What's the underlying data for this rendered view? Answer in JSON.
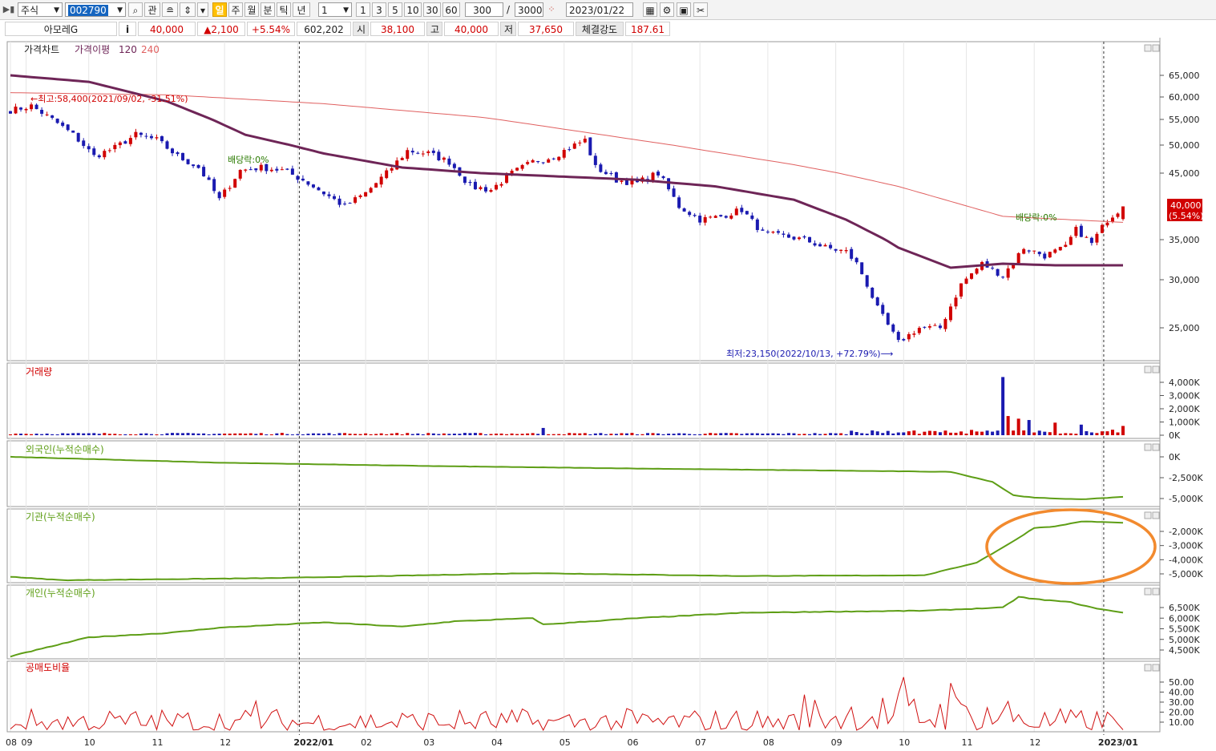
{
  "toolbar": {
    "market": "주식",
    "code": "002790",
    "btn_gwan": "관",
    "periods": [
      "일",
      "주",
      "월",
      "분",
      "틱",
      "년"
    ],
    "active_period": "일",
    "interval_value": "1",
    "intervals": [
      "1",
      "3",
      "5",
      "10",
      "30",
      "60"
    ],
    "count_value": "300",
    "count_sep": "/",
    "count_max": "3000",
    "date": "2023/01/22"
  },
  "quote": {
    "name": "아모레G",
    "info_btn": "i",
    "price": "40,000",
    "change": "▲2,100",
    "change_pct": "+5.54%",
    "volume": "602,202",
    "open_label": "시",
    "open": "38,100",
    "high_label": "고",
    "high": "40,000",
    "low_label": "저",
    "low": "37,650",
    "strength_label": "체결강도",
    "strength": "187.61"
  },
  "chart_data": [
    {
      "type": "candlestick",
      "panel": "price",
      "title": "가격차트",
      "legend": [
        "가격이평",
        "120",
        "240"
      ],
      "y_ticks": [
        65000,
        60000,
        55000,
        50000,
        45000,
        35000,
        30000,
        25000
      ],
      "y_tick_labels": [
        "65,000",
        "60,000",
        "55,000",
        "50,000",
        "45,000",
        "35,000",
        "30,000",
        "25,000"
      ],
      "last_price_label": "40,000",
      "last_pct_label": "(5.54%)",
      "annotations": {
        "high": "←최고:58,400(2021/09/02, -31.51%)",
        "low": "최저:23,150(2022/10/13, +72.79%)⟶",
        "div1": "배당락:0%",
        "div2": "배당락:0%"
      },
      "close_anchors": [
        [
          0,
          57000
        ],
        [
          4,
          58000
        ],
        [
          8,
          55000
        ],
        [
          12,
          52000
        ],
        [
          16,
          48000
        ],
        [
          20,
          49500
        ],
        [
          24,
          52000
        ],
        [
          28,
          51000
        ],
        [
          32,
          48000
        ],
        [
          36,
          46000
        ],
        [
          40,
          41000
        ],
        [
          44,
          45500
        ],
        [
          48,
          46000
        ],
        [
          52,
          45500
        ],
        [
          56,
          44000
        ],
        [
          60,
          42000
        ],
        [
          64,
          40000
        ],
        [
          68,
          42000
        ],
        [
          72,
          45000
        ],
        [
          76,
          49000
        ],
        [
          80,
          48500
        ],
        [
          84,
          47000
        ],
        [
          88,
          43000
        ],
        [
          92,
          42500
        ],
        [
          96,
          45000
        ],
        [
          100,
          47000
        ],
        [
          104,
          48000
        ],
        [
          108,
          50000
        ],
        [
          110,
          51000
        ],
        [
          112,
          46000
        ],
        [
          116,
          44000
        ],
        [
          120,
          43500
        ],
        [
          124,
          45000
        ],
        [
          128,
          40000
        ],
        [
          132,
          38000
        ],
        [
          136,
          38500
        ],
        [
          140,
          39500
        ],
        [
          144,
          36000
        ],
        [
          148,
          35500
        ],
        [
          152,
          35000
        ],
        [
          156,
          34000
        ],
        [
          160,
          33500
        ],
        [
          162,
          32000
        ],
        [
          166,
          27000
        ],
        [
          170,
          23500
        ],
        [
          174,
          25000
        ],
        [
          178,
          25000
        ],
        [
          182,
          29500
        ],
        [
          186,
          32000
        ],
        [
          190,
          30500
        ],
        [
          194,
          34000
        ],
        [
          198,
          33000
        ],
        [
          202,
          34000
        ],
        [
          204,
          36500
        ],
        [
          207,
          34500
        ],
        [
          210,
          38000
        ],
        [
          213,
          40000
        ]
      ],
      "ma120_anchors": [
        [
          0,
          65000
        ],
        [
          15,
          63500
        ],
        [
          30,
          59000
        ],
        [
          45,
          52000
        ],
        [
          60,
          48500
        ],
        [
          75,
          46000
        ],
        [
          90,
          45000
        ],
        [
          105,
          44500
        ],
        [
          120,
          44000
        ],
        [
          135,
          43000
        ],
        [
          150,
          41000
        ],
        [
          160,
          38000
        ],
        [
          170,
          34000
        ],
        [
          180,
          31500
        ],
        [
          190,
          32000
        ],
        [
          200,
          31800
        ],
        [
          213,
          31800
        ]
      ],
      "ma240_anchors": [
        [
          0,
          61000
        ],
        [
          30,
          60500
        ],
        [
          60,
          58500
        ],
        [
          90,
          55500
        ],
        [
          120,
          51000
        ],
        [
          150,
          46500
        ],
        [
          170,
          43000
        ],
        [
          190,
          38500
        ],
        [
          213,
          37600
        ]
      ],
      "last_volume_ticks_note": ""
    },
    {
      "type": "bar",
      "panel": "volume",
      "title": "거래량",
      "y_tick_labels": [
        "4,000K",
        "3,000K",
        "2,000K",
        "1,000K",
        "0K"
      ],
      "y_ticks": [
        4000,
        3000,
        2000,
        1000,
        0
      ],
      "unit": "K",
      "spikes": [
        [
          102,
          550
        ],
        [
          190,
          4400
        ],
        [
          191,
          1450
        ],
        [
          193,
          1250
        ],
        [
          195,
          1150
        ],
        [
          200,
          950
        ],
        [
          205,
          800
        ],
        [
          213,
          700
        ]
      ]
    },
    {
      "type": "line",
      "panel": "foreign",
      "title": "외국인(누적순매수)",
      "y_tick_labels": [
        "0K",
        "-2,500K",
        "-5,000K"
      ],
      "y_ticks": [
        0,
        -2500,
        -5000
      ],
      "anchors": [
        [
          0,
          0
        ],
        [
          40,
          -700
        ],
        [
          80,
          -1100
        ],
        [
          120,
          -1400
        ],
        [
          150,
          -1600
        ],
        [
          180,
          -1800
        ],
        [
          188,
          -3000
        ],
        [
          192,
          -4600
        ],
        [
          196,
          -4900
        ],
        [
          205,
          -5100
        ],
        [
          213,
          -4800
        ]
      ]
    },
    {
      "type": "line",
      "panel": "institution",
      "title": "기관(누적순매수)",
      "y_tick_labels": [
        "-2,000K",
        "-3,000K",
        "-4,000K",
        "-5,000K"
      ],
      "y_ticks": [
        -2000,
        -3000,
        -4000,
        -5000
      ],
      "anchors": [
        [
          0,
          -5200
        ],
        [
          10,
          -5450
        ],
        [
          50,
          -5300
        ],
        [
          100,
          -4950
        ],
        [
          140,
          -5150
        ],
        [
          175,
          -5100
        ],
        [
          185,
          -4200
        ],
        [
          192,
          -2700
        ],
        [
          196,
          -1750
        ],
        [
          200,
          -1650
        ],
        [
          205,
          -1300
        ],
        [
          210,
          -1350
        ],
        [
          213,
          -1400
        ]
      ]
    },
    {
      "type": "line",
      "panel": "individual",
      "title": "개인(누적순매수)",
      "y_tick_labels": [
        "6,500K",
        "6,000K",
        "5,500K",
        "5,000K",
        "4,500K"
      ],
      "y_ticks": [
        6500,
        6000,
        5500,
        5000,
        4500
      ],
      "anchors": [
        [
          0,
          4200
        ],
        [
          5,
          4500
        ],
        [
          15,
          5100
        ],
        [
          30,
          5300
        ],
        [
          40,
          5550
        ],
        [
          60,
          5800
        ],
        [
          75,
          5600
        ],
        [
          85,
          5850
        ],
        [
          100,
          6000
        ],
        [
          102,
          5700
        ],
        [
          120,
          6000
        ],
        [
          140,
          6250
        ],
        [
          155,
          6300
        ],
        [
          175,
          6350
        ],
        [
          185,
          6450
        ],
        [
          190,
          6500
        ],
        [
          193,
          7000
        ],
        [
          196,
          6900
        ],
        [
          203,
          6750
        ],
        [
          207,
          6500
        ],
        [
          213,
          6250
        ]
      ]
    },
    {
      "type": "line",
      "panel": "short",
      "title": "공매도비율",
      "y_tick_labels": [
        "50.00",
        "40.00",
        "30.00",
        "20.00",
        "10.00"
      ],
      "y_ticks": [
        50,
        40,
        30,
        20,
        10
      ]
    }
  ],
  "x_axis": {
    "labels": [
      {
        "i": 0,
        "t": "08"
      },
      {
        "i": 3,
        "t": "09"
      },
      {
        "i": 15,
        "t": "10"
      },
      {
        "i": 28,
        "t": "11"
      },
      {
        "i": 41,
        "t": "12"
      },
      {
        "i": 55,
        "t": "2022/01"
      },
      {
        "i": 68,
        "t": "02"
      },
      {
        "i": 80,
        "t": "03"
      },
      {
        "i": 93,
        "t": "04"
      },
      {
        "i": 106,
        "t": "05"
      },
      {
        "i": 119,
        "t": "06"
      },
      {
        "i": 132,
        "t": "07"
      },
      {
        "i": 145,
        "t": "08"
      },
      {
        "i": 158,
        "t": "09"
      },
      {
        "i": 171,
        "t": "10"
      },
      {
        "i": 183,
        "t": "11"
      },
      {
        "i": 196,
        "t": "12"
      },
      {
        "i": 209,
        "t": "2023/01"
      }
    ]
  },
  "colors": {
    "up": "#d10000",
    "down": "#1a1ab0",
    "ma120": "#6e2557",
    "ma240": "#e06060",
    "flow": "#5e9e16",
    "short": "#d01010",
    "highlight": "#f28a2e"
  }
}
